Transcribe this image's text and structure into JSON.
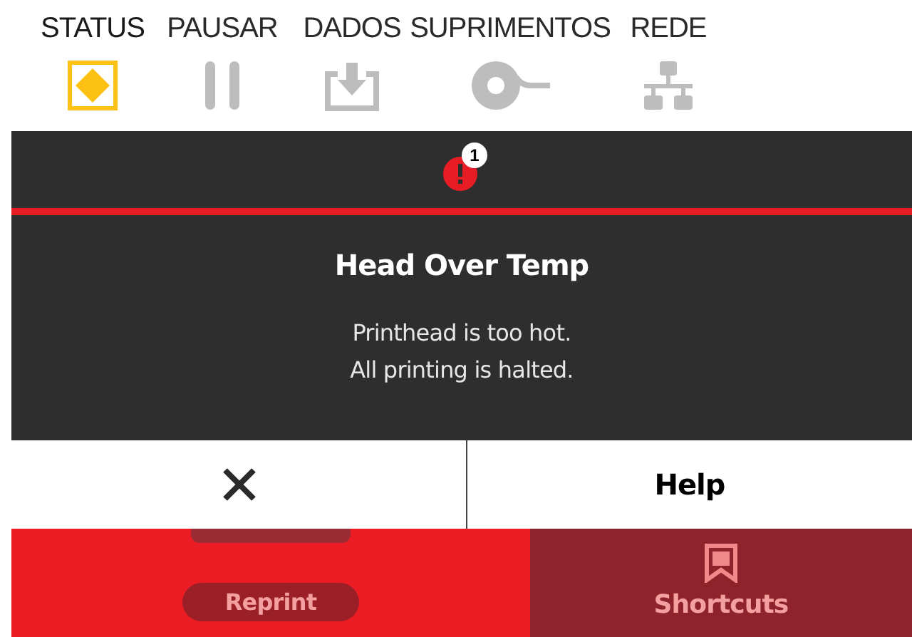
{
  "nav_tabs": [
    {
      "label": "STATUS",
      "kind": "status",
      "selected": true
    },
    {
      "label": "PAUSAR",
      "kind": "pause",
      "selected": false
    },
    {
      "label": "DADOS",
      "kind": "data",
      "selected": false
    },
    {
      "label": "SUPRIMENTOS",
      "kind": "supplies",
      "selected": false
    },
    {
      "label": "REDE",
      "kind": "network",
      "selected": false
    }
  ],
  "alert": {
    "badge": "1",
    "title": "Head Over Temp",
    "message_lines": [
      "Printhead is too hot.",
      "All printing is halted."
    ],
    "help_button": "Help"
  },
  "background": {
    "reprint": "Reprint",
    "shortcuts": "Shortcuts"
  }
}
